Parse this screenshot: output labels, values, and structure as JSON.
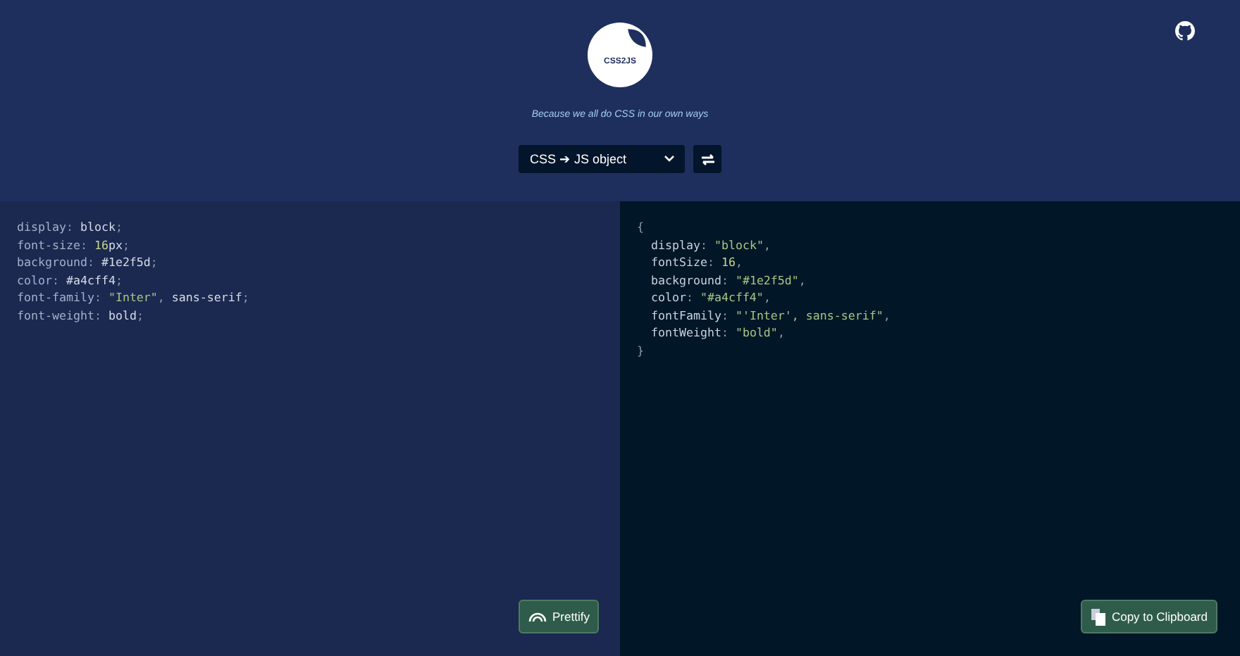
{
  "logo": {
    "text": "CSS2JS"
  },
  "tagline": "Because we all do CSS in our own ways",
  "mode_select": {
    "value": "CSS ➔ JS object"
  },
  "input_code": [
    [
      {
        "text": "display",
        "kind": "key"
      },
      {
        "text": ": ",
        "kind": "punct"
      },
      {
        "text": "block",
        "kind": "plain"
      },
      {
        "text": ";",
        "kind": "punct"
      }
    ],
    [
      {
        "text": "font-size",
        "kind": "key"
      },
      {
        "text": ": ",
        "kind": "punct"
      },
      {
        "text": "16",
        "kind": "number"
      },
      {
        "text": "px",
        "kind": "plain"
      },
      {
        "text": ";",
        "kind": "punct"
      }
    ],
    [
      {
        "text": "background",
        "kind": "key"
      },
      {
        "text": ": ",
        "kind": "punct"
      },
      {
        "text": "#1e2f5d",
        "kind": "plain"
      },
      {
        "text": ";",
        "kind": "punct"
      }
    ],
    [
      {
        "text": "color",
        "kind": "key"
      },
      {
        "text": ": ",
        "kind": "punct"
      },
      {
        "text": "#a4cff4",
        "kind": "plain"
      },
      {
        "text": ";",
        "kind": "punct"
      }
    ],
    [
      {
        "text": "font-family",
        "kind": "key"
      },
      {
        "text": ": ",
        "kind": "punct"
      },
      {
        "text": "\"Inter\"",
        "kind": "string"
      },
      {
        "text": ", ",
        "kind": "punct"
      },
      {
        "text": "sans-serif",
        "kind": "plain"
      },
      {
        "text": ";",
        "kind": "punct"
      }
    ],
    [
      {
        "text": "font-weight",
        "kind": "key"
      },
      {
        "text": ": ",
        "kind": "punct"
      },
      {
        "text": "bold",
        "kind": "plain"
      },
      {
        "text": ";",
        "kind": "punct"
      }
    ]
  ],
  "output_code": [
    [
      {
        "text": "{",
        "kind": "punct"
      }
    ],
    [
      {
        "text": "  display",
        "kind": "plain"
      },
      {
        "text": ": ",
        "kind": "punct"
      },
      {
        "text": "\"block\"",
        "kind": "string"
      },
      {
        "text": ",",
        "kind": "punct"
      }
    ],
    [
      {
        "text": "  fontSize",
        "kind": "plain"
      },
      {
        "text": ": ",
        "kind": "punct"
      },
      {
        "text": "16",
        "kind": "number"
      },
      {
        "text": ",",
        "kind": "punct"
      }
    ],
    [
      {
        "text": "  background",
        "kind": "plain"
      },
      {
        "text": ": ",
        "kind": "punct"
      },
      {
        "text": "\"#1e2f5d\"",
        "kind": "string"
      },
      {
        "text": ",",
        "kind": "punct"
      }
    ],
    [
      {
        "text": "  color",
        "kind": "plain"
      },
      {
        "text": ": ",
        "kind": "punct"
      },
      {
        "text": "\"#a4cff4\"",
        "kind": "string"
      },
      {
        "text": ",",
        "kind": "punct"
      }
    ],
    [
      {
        "text": "  fontFamily",
        "kind": "plain"
      },
      {
        "text": ": ",
        "kind": "punct"
      },
      {
        "text": "\"'Inter', sans-serif\"",
        "kind": "string"
      },
      {
        "text": ",",
        "kind": "punct"
      }
    ],
    [
      {
        "text": "  fontWeight",
        "kind": "plain"
      },
      {
        "text": ": ",
        "kind": "punct"
      },
      {
        "text": "\"bold\"",
        "kind": "string"
      },
      {
        "text": ",",
        "kind": "punct"
      }
    ],
    [
      {
        "text": "}",
        "kind": "punct"
      }
    ]
  ],
  "prettify_button": "Prettify",
  "copy_button": "Copy to Clipboard"
}
